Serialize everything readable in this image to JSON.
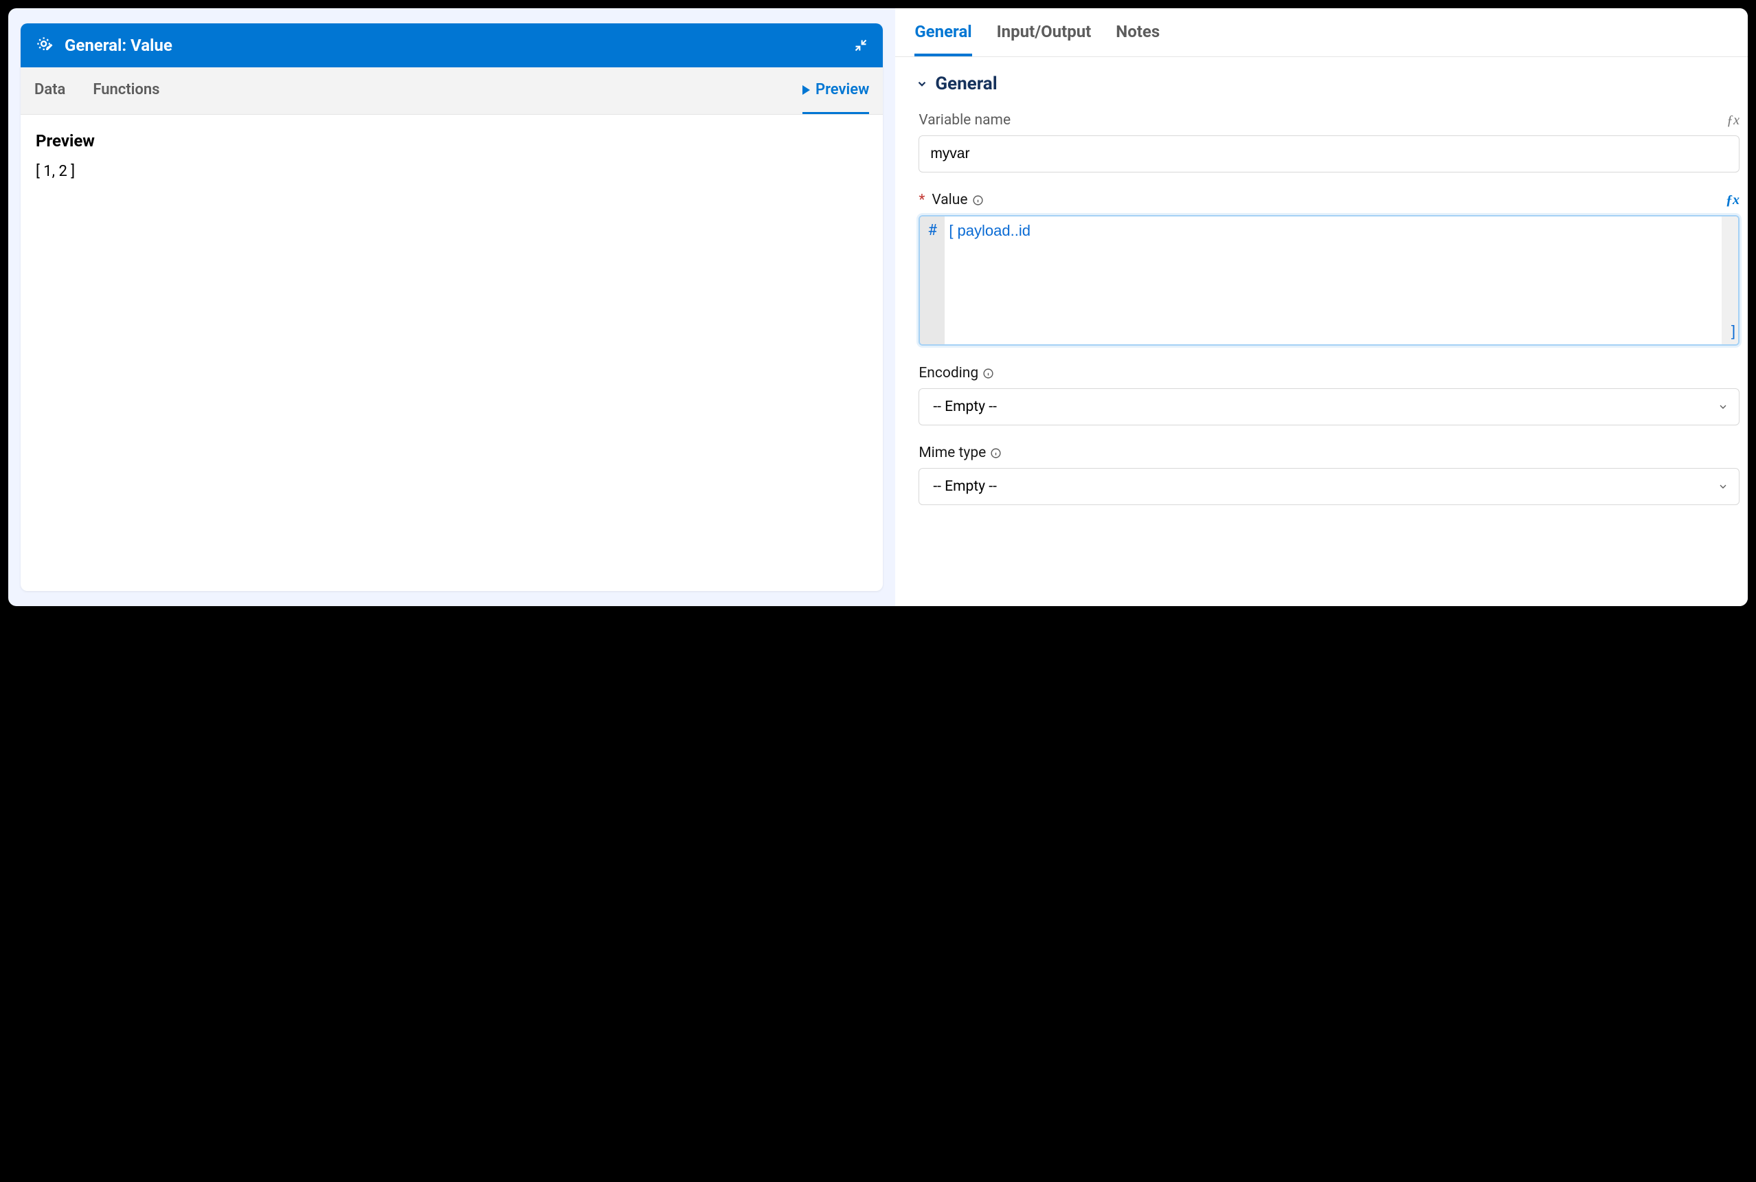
{
  "leftPanel": {
    "headerTitle": "General: Value",
    "tabs": {
      "data": "Data",
      "functions": "Functions",
      "preview": "Preview"
    },
    "body": {
      "previewTitle": "Preview",
      "previewContent": "[ 1, 2 ]"
    }
  },
  "rightPanel": {
    "tabs": {
      "general": "General",
      "inputOutput": "Input/Output",
      "notes": "Notes"
    },
    "sectionTitle": "General",
    "fields": {
      "variableName": {
        "label": "Variable name",
        "value": "myvar"
      },
      "value": {
        "label": "Value",
        "hash": "#",
        "bracketOpen": "[",
        "expression": " payload..id",
        "bracketClose": "]"
      },
      "encoding": {
        "label": "Encoding",
        "value": "-- Empty --"
      },
      "mimeType": {
        "label": "Mime type",
        "value": "-- Empty --"
      }
    }
  }
}
